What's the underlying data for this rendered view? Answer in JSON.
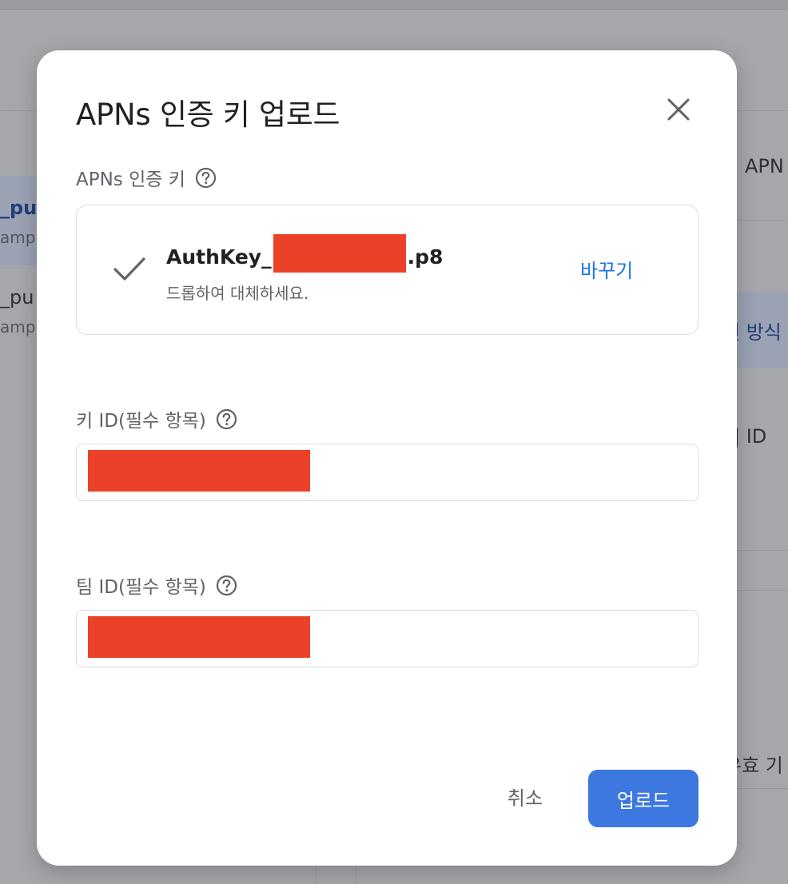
{
  "background": {
    "left_items": [
      {
        "title": "_pu",
        "subtitle": "amp"
      },
      {
        "title": "_pu",
        "subtitle": "amp"
      }
    ],
    "right_labels": {
      "apn": "APN",
      "method": "인 방식",
      "id": "| ID",
      "expiry": "유효 기"
    }
  },
  "dialog": {
    "title": "APNs 인증 키 업로드",
    "close_icon": "close-icon",
    "auth_key": {
      "label": "APNs 인증 키",
      "help_icon": "help-circle-icon",
      "file_name_prefix": "AuthKey_",
      "file_name_suffix": ".p8",
      "hint": "드롭하여 대체하세요.",
      "replace_label": "바꾸기",
      "status_icon": "check-icon"
    },
    "key_id": {
      "label": "키 ID(필수 항목)",
      "help_icon": "help-circle-icon",
      "value": ""
    },
    "team_id": {
      "label": "팀 ID(필수 항목)",
      "help_icon": "help-circle-icon",
      "value": ""
    },
    "buttons": {
      "cancel": "취소",
      "upload": "업로드"
    }
  },
  "colors": {
    "primary": "#3c78e0",
    "link": "#1a73e8",
    "redaction": "#ea4128",
    "overlay": "#a5a7ab"
  }
}
